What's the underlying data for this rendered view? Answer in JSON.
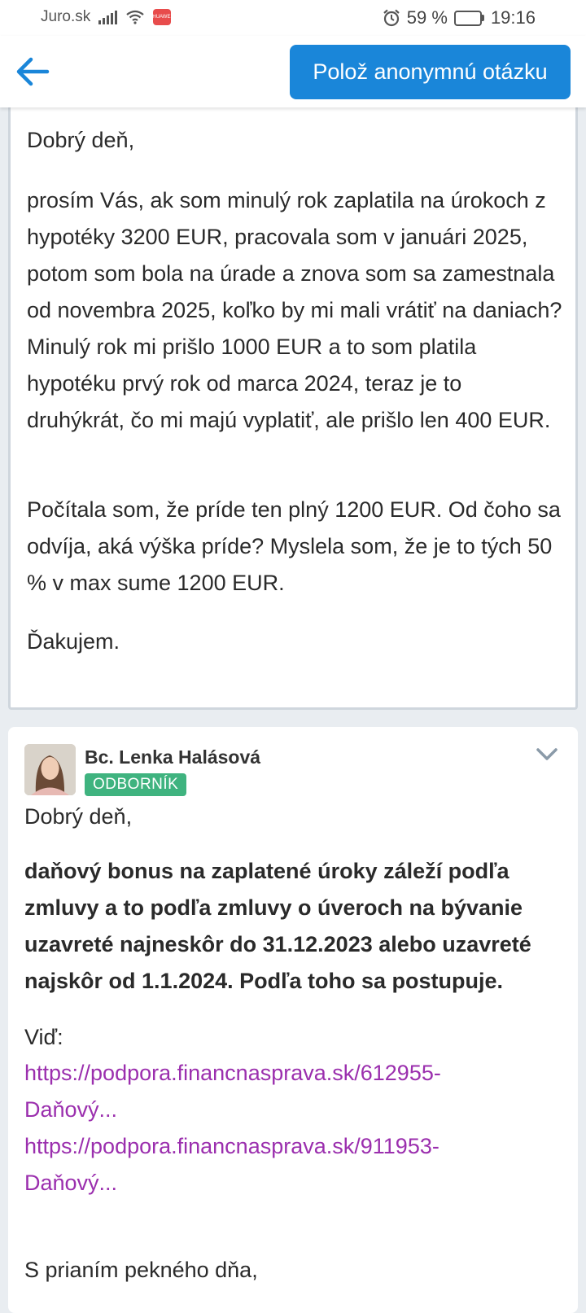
{
  "status_bar": {
    "carrier": "Juro.sk",
    "app_badge": "HUAWEI",
    "battery": "59 %",
    "battery_level": 0.59,
    "time": "19:16"
  },
  "header": {
    "back_icon": "arrow-left-icon",
    "ask_button_label": "Polož anonymnú otázku",
    "accent_color": "#1a86d9"
  },
  "question": {
    "greeting": "Dobrý deň,",
    "paragraph_1": "prosím Vás, ak som minulý rok zaplatila na úrokoch z hypotéky 3200 EUR, pracovala som v januári 2025, potom som bola na úrade a znova som sa zamestnala od novembra 2025, koľko by mi mali vrátiť na daniach? Minulý rok mi prišlo 1000 EUR a to som platila hypotéku prvý rok od marca 2024, teraz je to druhýkrát, čo mi majú vyplatiť, ale prišlo len 400 EUR.",
    "paragraph_2": "Počítala som, že príde ten plný 1200 EUR. Od čoho sa odvíja, aká výška príde? Myslela som, že je to tých 50 % v max sume 1200 EUR.",
    "closing": "Ďakujem."
  },
  "answer": {
    "author": "Bc. Lenka Halásová",
    "badge": "ODBORNÍK",
    "badge_color": "#3fb37f",
    "greeting": "Dobrý deň,",
    "bold_paragraph": "daňový bonus na zaplatené úroky záleží podľa zmluvy a to podľa zmluvy o úveroch na bývanie uzavreté najneskôr do 31.12.2023 alebo uzavreté najskôr od 1.1.2024. Podľa toho sa postupuje.",
    "see_label": "Viď:",
    "links": [
      "https://podpora.financnasprava.sk/612955-Daňový...",
      "https://podpora.financnasprava.sk/911953-Daňový..."
    ],
    "link_color": "#9b2fae",
    "signoff": "S prianím pekného dňa,"
  }
}
